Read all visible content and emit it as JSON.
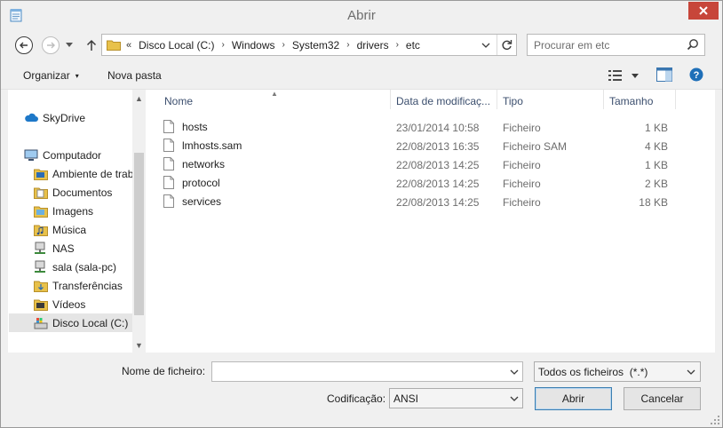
{
  "window": {
    "title": "Abrir"
  },
  "address": {
    "lead_chevron": "«",
    "crumbs": [
      "Disco Local (C:)",
      "Windows",
      "System32",
      "drivers",
      "etc"
    ],
    "separator": "›"
  },
  "search": {
    "placeholder": "Procurar em etc"
  },
  "toolbar": {
    "organize_label": "Organizar",
    "organize_caret": "▾",
    "new_folder_label": "Nova pasta"
  },
  "nav": {
    "items": [
      {
        "label": "SkyDrive",
        "icon": "cloud-icon"
      },
      {
        "label": "Computador",
        "icon": "computer-icon"
      },
      {
        "label": "Ambiente de trabalho",
        "icon": "folder-icon"
      },
      {
        "label": "Documentos",
        "icon": "folder-icon"
      },
      {
        "label": "Imagens",
        "icon": "folder-icon"
      },
      {
        "label": "Música",
        "icon": "folder-icon"
      },
      {
        "label": "NAS",
        "icon": "network-drive-icon"
      },
      {
        "label": "sala (sala-pc)",
        "icon": "network-drive-icon"
      },
      {
        "label": "Transferências",
        "icon": "folder-icon"
      },
      {
        "label": "Vídeos",
        "icon": "folder-icon"
      },
      {
        "label": "Disco Local (C:)",
        "icon": "drive-icon"
      }
    ],
    "selected": "Disco Local (C:)"
  },
  "files": {
    "columns": [
      "Nome",
      "Data de modificaç...",
      "Tipo",
      "Tamanho"
    ],
    "rows": [
      {
        "name": "hosts",
        "modified": "23/01/2014 10:58",
        "type": "Ficheiro",
        "size": "1 KB"
      },
      {
        "name": "lmhosts.sam",
        "modified": "22/08/2013 16:35",
        "type": "Ficheiro SAM",
        "size": "4 KB"
      },
      {
        "name": "networks",
        "modified": "22/08/2013 14:25",
        "type": "Ficheiro",
        "size": "1 KB"
      },
      {
        "name": "protocol",
        "modified": "22/08/2013 14:25",
        "type": "Ficheiro",
        "size": "2 KB"
      },
      {
        "name": "services",
        "modified": "22/08/2013 14:25",
        "type": "Ficheiro",
        "size": "18 KB"
      }
    ]
  },
  "bottom": {
    "filename_label": "Nome de ficheiro:",
    "filename_value": "",
    "filter_value": "Todos os ficheiros  (*.*)",
    "encoding_label": "Codificação:",
    "encoding_value": "ANSI",
    "open_label": "Abrir",
    "cancel_label": "Cancelar"
  },
  "colors": {
    "close_button": "#c7463a",
    "folder": "#e8c14a",
    "header_text": "#3c4f6e",
    "selection": "#e5e5e5",
    "accent_blue": "#1e6fb8"
  }
}
